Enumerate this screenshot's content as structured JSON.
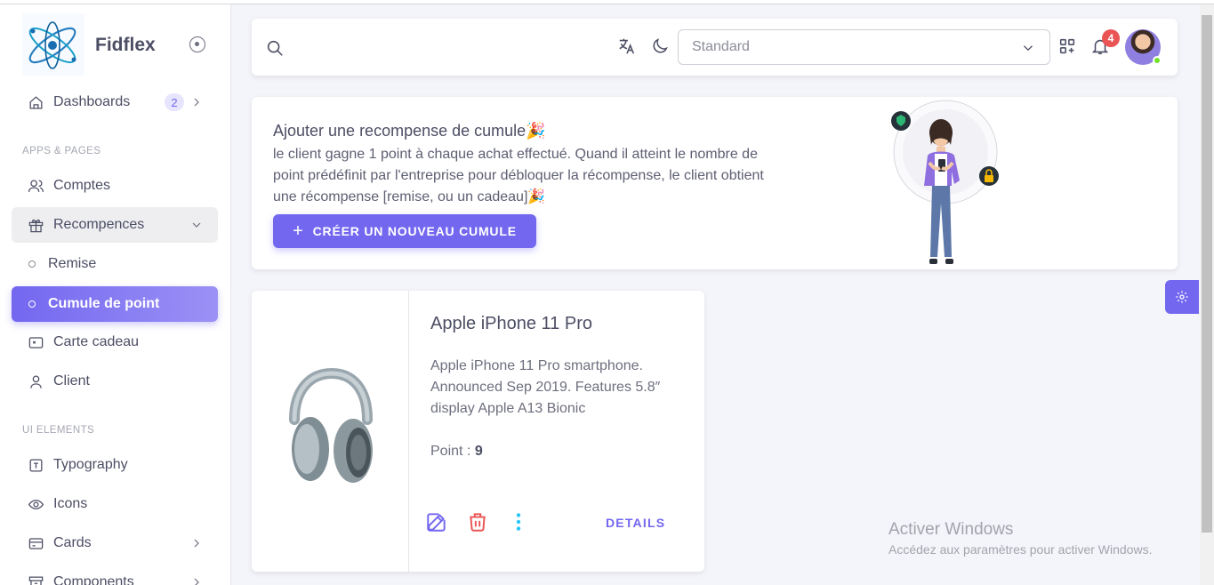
{
  "app": {
    "name": "Fidflex"
  },
  "sidebar": {
    "sections": [
      "Apps & Pages",
      "UI Elements"
    ],
    "items": [
      {
        "label": "Dashboards",
        "badge": "2",
        "icon": "home-icon"
      },
      {
        "label": "Comptes",
        "icon": "users-icon"
      },
      {
        "label": "Recompences",
        "icon": "gift-icon"
      },
      {
        "label": "Remise",
        "icon": "circle-icon"
      },
      {
        "label": "Cumule de point",
        "icon": "circle-icon"
      },
      {
        "label": "Carte cadeau",
        "icon": "card-icon"
      },
      {
        "label": "Client",
        "icon": "user-icon"
      },
      {
        "label": "Typography",
        "icon": "text-icon"
      },
      {
        "label": "Icons",
        "icon": "eye-icon"
      },
      {
        "label": "Cards",
        "icon": "cards-icon"
      },
      {
        "label": "Components",
        "icon": "archive-icon"
      }
    ]
  },
  "header": {
    "select_value": "Standard",
    "notification_count": "4"
  },
  "banner": {
    "title": "Ajouter une recompense de cumule🎉",
    "text": "le client gagne 1 point à chaque achat effectué. Quand il atteint le nombre de point prédéfinit par l'entreprise pour débloquer la récompense, le client obtient une récompense [remise, ou un cadeau]🎉",
    "button_label": "Créer un nouveau cumule"
  },
  "product": {
    "title": "Apple iPhone 11 Pro",
    "description": "Apple iPhone 11 Pro smartphone. Announced Sep 2019. Features 5.8″ display Apple A13 Bionic",
    "points_label": "Point : ",
    "points_value": "9",
    "details_label": "DETAILS"
  },
  "watermark": {
    "line1": "Activer Windows",
    "line2": "Accédez aux paramètres pour activer Windows."
  },
  "colors": {
    "primary": "#7367f0",
    "danger": "#ea5455",
    "info": "#26c6f9",
    "success": "#72e128"
  }
}
